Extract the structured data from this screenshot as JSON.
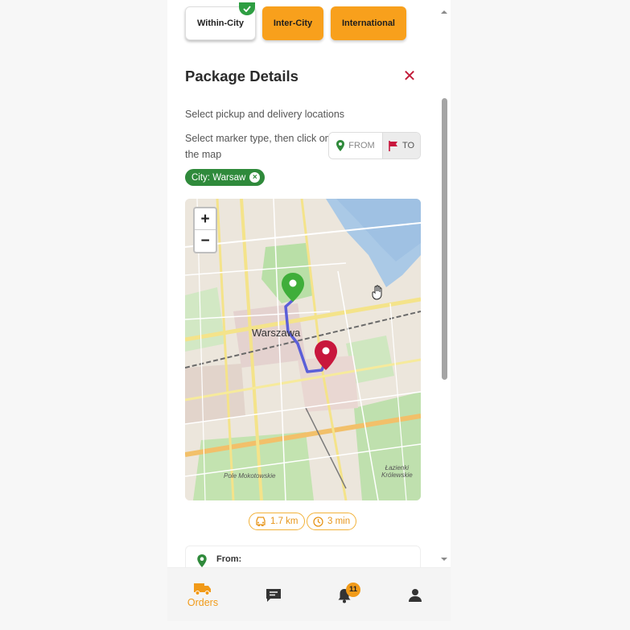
{
  "tabs": [
    {
      "label": "Within-City",
      "active": true
    },
    {
      "label": "Inter-City",
      "active": false
    },
    {
      "label": "International",
      "active": false
    }
  ],
  "header": {
    "title": "Package Details",
    "close_icon": "close-icon"
  },
  "instructions": {
    "line1": "Select pickup and delivery locations",
    "line2": "Select marker type, then click on the map"
  },
  "marker_toggle": {
    "from_label": "FROM",
    "to_label": "TO",
    "selected": "TO"
  },
  "city_chip": {
    "label": "City: Warsaw"
  },
  "map": {
    "city_label": "Warszawa",
    "park_left": "Pole Mokotowskie",
    "park_right_1": "Łazienki",
    "park_right_2": "Królewskie",
    "zoom_in": "+",
    "zoom_out": "−",
    "colors": {
      "from_marker": "#3fae3a",
      "to_marker": "#c8173d",
      "route": "#5b5fd8"
    }
  },
  "route_info": {
    "distance": "1.7 km",
    "duration": "3 min"
  },
  "from_card": {
    "label": "From:"
  },
  "bottom_nav": {
    "orders_label": "Orders",
    "notification_count": "11",
    "accent": "#f19a18"
  }
}
